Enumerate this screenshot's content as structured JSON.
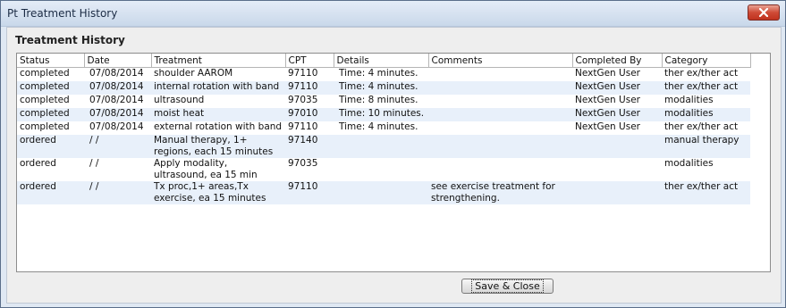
{
  "window": {
    "title": "Pt Treatment History"
  },
  "section_title": "Treatment History",
  "table": {
    "headers": [
      "Status",
      "Date",
      "Treatment",
      "CPT",
      "Details",
      "Comments",
      "Completed By",
      "Category"
    ],
    "rows": [
      {
        "status": "completed",
        "date": "07/08/2014",
        "treatment": "shoulder AAROM",
        "cpt": "97110",
        "details": "Time: 4 minutes.",
        "comments": "",
        "completed_by": "NextGen User",
        "category": "ther ex/ther act"
      },
      {
        "status": "completed",
        "date": "07/08/2014",
        "treatment": "internal rotation with band",
        "cpt": "97110",
        "details": "Time: 4 minutes.",
        "comments": "",
        "completed_by": "NextGen User",
        "category": "ther ex/ther act"
      },
      {
        "status": "completed",
        "date": "07/08/2014",
        "treatment": "ultrasound",
        "cpt": "97035",
        "details": "Time: 8 minutes.",
        "comments": "",
        "completed_by": "NextGen User",
        "category": "modalities"
      },
      {
        "status": "completed",
        "date": "07/08/2014",
        "treatment": "moist heat",
        "cpt": "97010",
        "details": "Time: 10 minutes.",
        "comments": "",
        "completed_by": "NextGen User",
        "category": "modalities"
      },
      {
        "status": "completed",
        "date": "07/08/2014",
        "treatment": "external rotation with band",
        "cpt": "97110",
        "details": "Time: 4 minutes.",
        "comments": "",
        "completed_by": "NextGen User",
        "category": "ther ex/ther act"
      },
      {
        "status": "ordered",
        "date": "/ /",
        "treatment": "Manual therapy, 1+ regions, each 15 minutes",
        "cpt": "97140",
        "details": "",
        "comments": "",
        "completed_by": "",
        "category": "manual therapy"
      },
      {
        "status": "ordered",
        "date": "/ /",
        "treatment": "Apply modality, ultrasound, ea 15 min",
        "cpt": "97035",
        "details": "",
        "comments": "",
        "completed_by": "",
        "category": "modalities"
      },
      {
        "status": "ordered",
        "date": "/ /",
        "treatment": "Tx proc,1+ areas,Tx exercise, ea 15 minutes",
        "cpt": "97110",
        "details": "",
        "comments": "see exercise treatment for strengthening.",
        "completed_by": "",
        "category": "ther ex/ther act"
      }
    ]
  },
  "buttons": {
    "save_close": "Save & Close"
  },
  "icons": {
    "close": "close-x-icon"
  },
  "colors": {
    "title_bar": "#c9d8ea",
    "close_button": "#c0321f",
    "row_alt": "#e8f0fa"
  }
}
